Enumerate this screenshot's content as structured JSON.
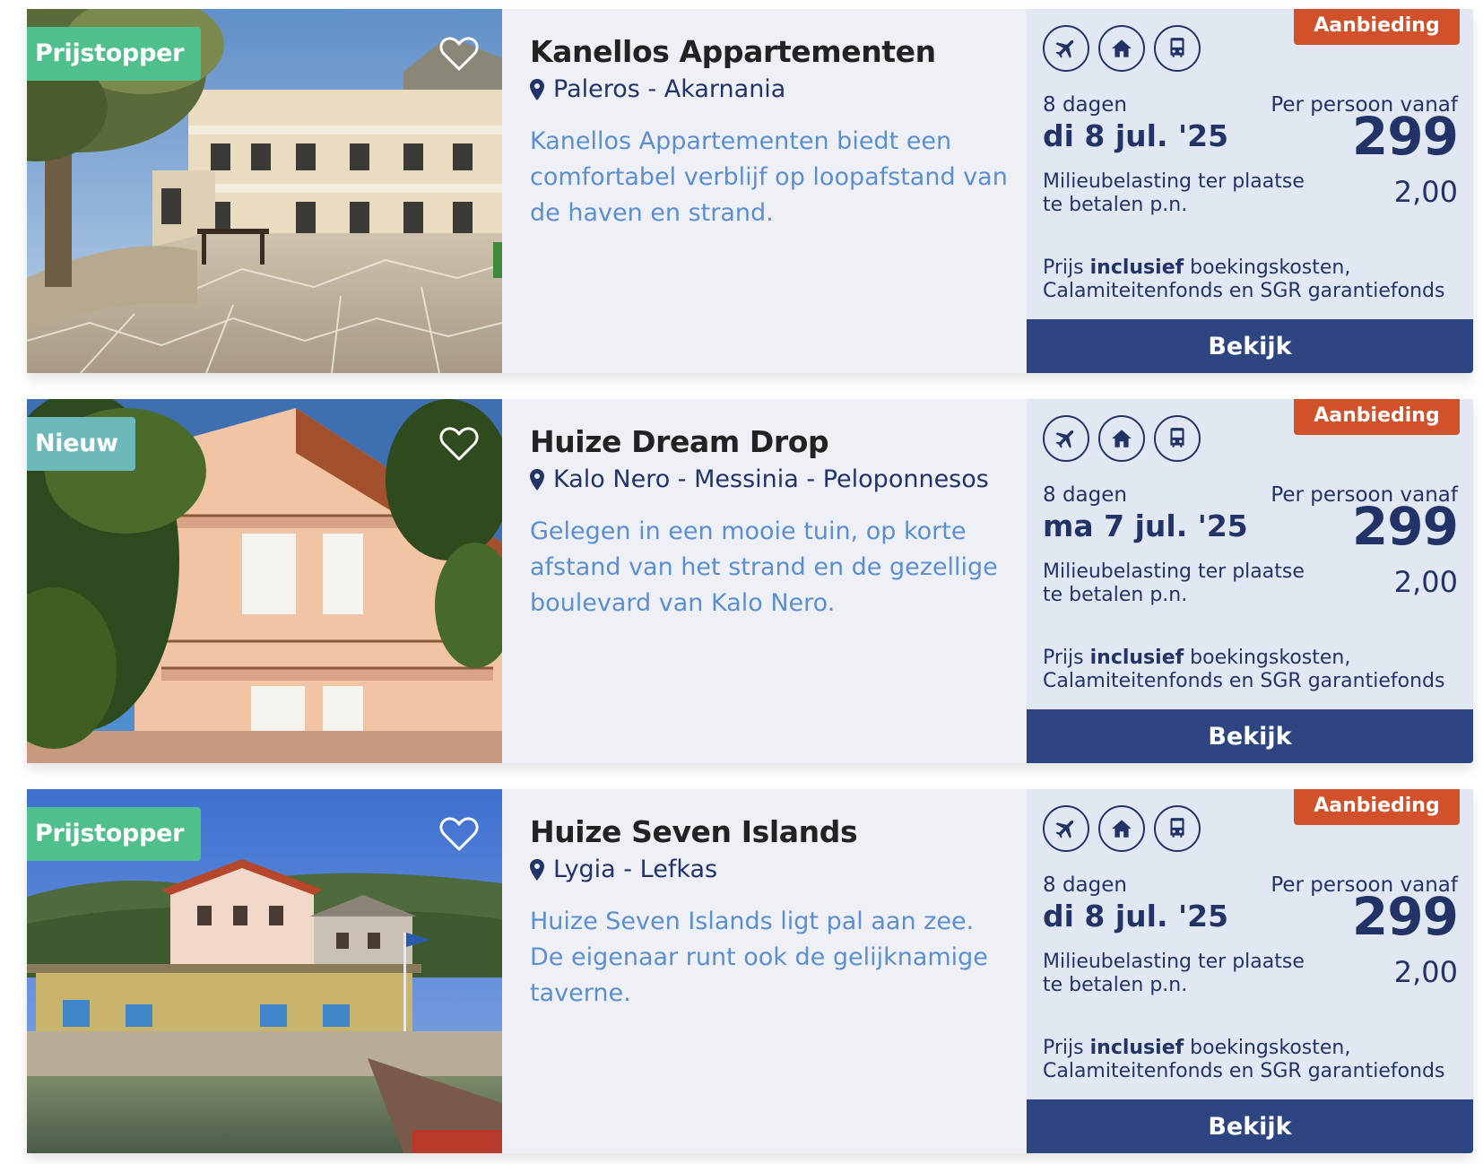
{
  "listings": [
    {
      "label": "Prijstopper",
      "title": "Kanellos Appartementen",
      "location": "Paleros - Akarnania",
      "description": "Kanellos Appartementen biedt een comfortabel verblijf op loopafstand van de haven en strand.",
      "offer_badge": "Aanbieding",
      "transport_icons": [
        "plane-icon",
        "home-icon",
        "bus-icon"
      ],
      "duration": "8 dagen",
      "date": "di 8 jul. '25",
      "price_label": "Per persoon vanaf",
      "price": "299",
      "tax_label": "Milieubelasting ter plaatse te betalen p.n.",
      "tax_value": "2,00",
      "included_prefix": "Prijs ",
      "included_bold": "inclusief",
      "included_rest": " boekingskosten, Calamiteitenfonds en SGR garantiefonds",
      "button": "Bekijk"
    },
    {
      "label": "Nieuw",
      "title": "Huize Dream Drop",
      "location": "Kalo Nero - Messinia - Peloponnesos",
      "description": "Gelegen in een mooie tuin, op korte afstand van het strand en de gezellige boulevard van Kalo Nero.",
      "offer_badge": "Aanbieding",
      "transport_icons": [
        "plane-icon",
        "home-icon",
        "bus-icon"
      ],
      "duration": "8 dagen",
      "date": "ma 7 jul. '25",
      "price_label": "Per persoon vanaf",
      "price": "299",
      "tax_label": "Milieubelasting ter plaatse te betalen p.n.",
      "tax_value": "2,00",
      "included_prefix": "Prijs ",
      "included_bold": "inclusief",
      "included_rest": " boekingskosten, Calamiteitenfonds en SGR garantiefonds",
      "button": "Bekijk"
    },
    {
      "label": "Prijstopper",
      "title": "Huize Seven Islands",
      "location": "Lygia - Lefkas",
      "description": "Huize Seven Islands ligt pal aan zee. De eigenaar runt ook de gelijknamige taverne.",
      "offer_badge": "Aanbieding",
      "transport_icons": [
        "plane-icon",
        "home-icon",
        "bus-icon"
      ],
      "duration": "8 dagen",
      "date": "di 8 jul. '25",
      "price_label": "Per persoon vanaf",
      "price": "299",
      "tax_label": "Milieubelasting ter plaatse te betalen p.n.",
      "tax_value": "2,00",
      "included_prefix": "Prijs ",
      "included_bold": "inclusief",
      "included_rest": " boekingskosten, Calamiteitenfonds en SGR garantiefonds",
      "button": "Bekijk"
    }
  ],
  "colors": {
    "primary": "#223467",
    "button": "#2d4681",
    "offer": "#d0512a",
    "label_prijstopper": "#4fbf8c",
    "label_nieuw": "#6db8b9",
    "description": "#5b8fd0"
  }
}
